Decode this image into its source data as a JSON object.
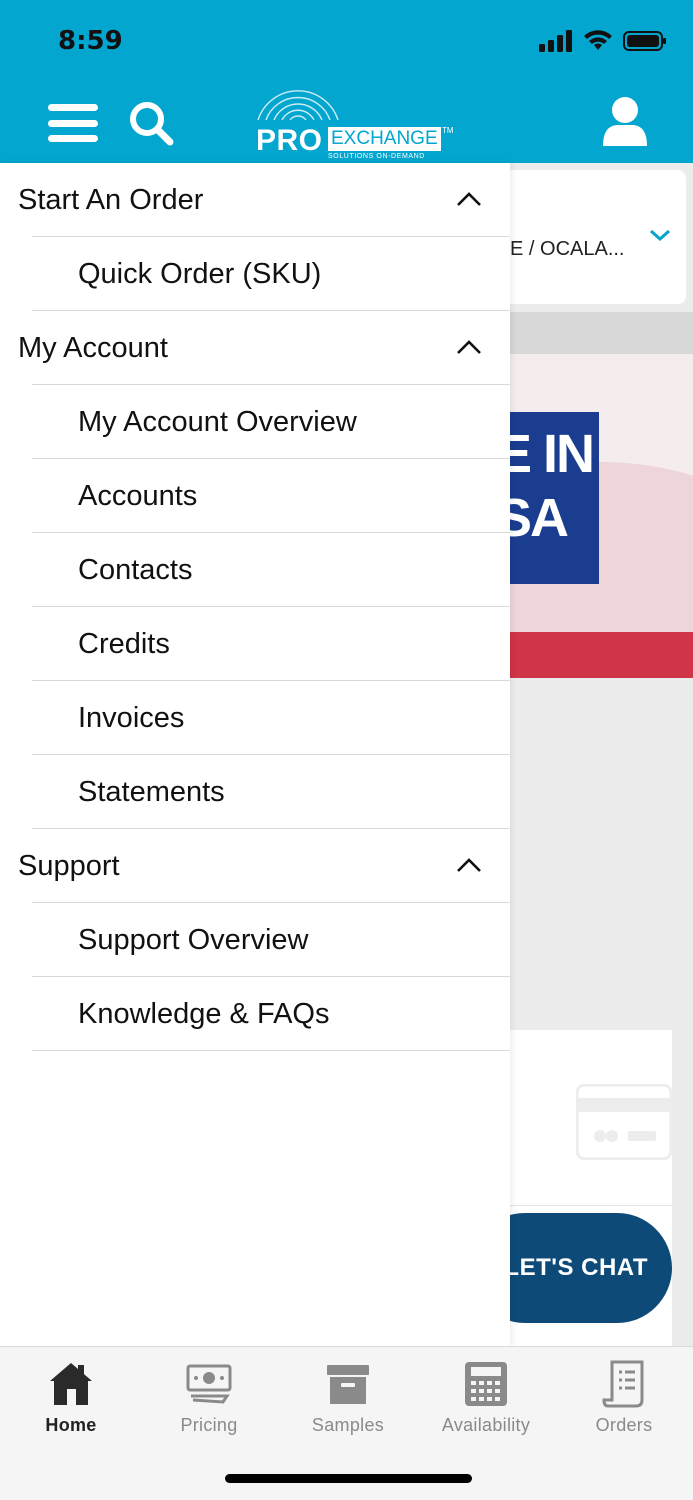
{
  "status_bar": {
    "time": "8:59"
  },
  "header": {
    "logo_primary": "PRO",
    "logo_secondary": "EXCHANGE",
    "logo_tm": "TM",
    "logo_tagline": "SOLUTIONS ON-DEMAND",
    "brand_color": "#03a6cf"
  },
  "background": {
    "location_text": "E / OCALA...",
    "banner_text_line1": "E IN",
    "banner_text_line2": "SA",
    "chat_label": "LET'S CHAT"
  },
  "drawer": {
    "sections": [
      {
        "label": "Start An Order",
        "items": [
          "Quick Order (SKU)"
        ]
      },
      {
        "label": "My Account",
        "items": [
          "My Account Overview",
          "Accounts",
          "Contacts",
          "Credits",
          "Invoices",
          "Statements"
        ]
      },
      {
        "label": "Support",
        "items": [
          "Support Overview",
          "Knowledge & FAQs"
        ]
      }
    ]
  },
  "tabbar": {
    "tabs": [
      {
        "label": "Home",
        "icon": "home-icon",
        "active": true
      },
      {
        "label": "Pricing",
        "icon": "money-icon",
        "active": false
      },
      {
        "label": "Samples",
        "icon": "box-icon",
        "active": false
      },
      {
        "label": "Availability",
        "icon": "calculator-icon",
        "active": false
      },
      {
        "label": "Orders",
        "icon": "receipt-icon",
        "active": false
      }
    ]
  }
}
